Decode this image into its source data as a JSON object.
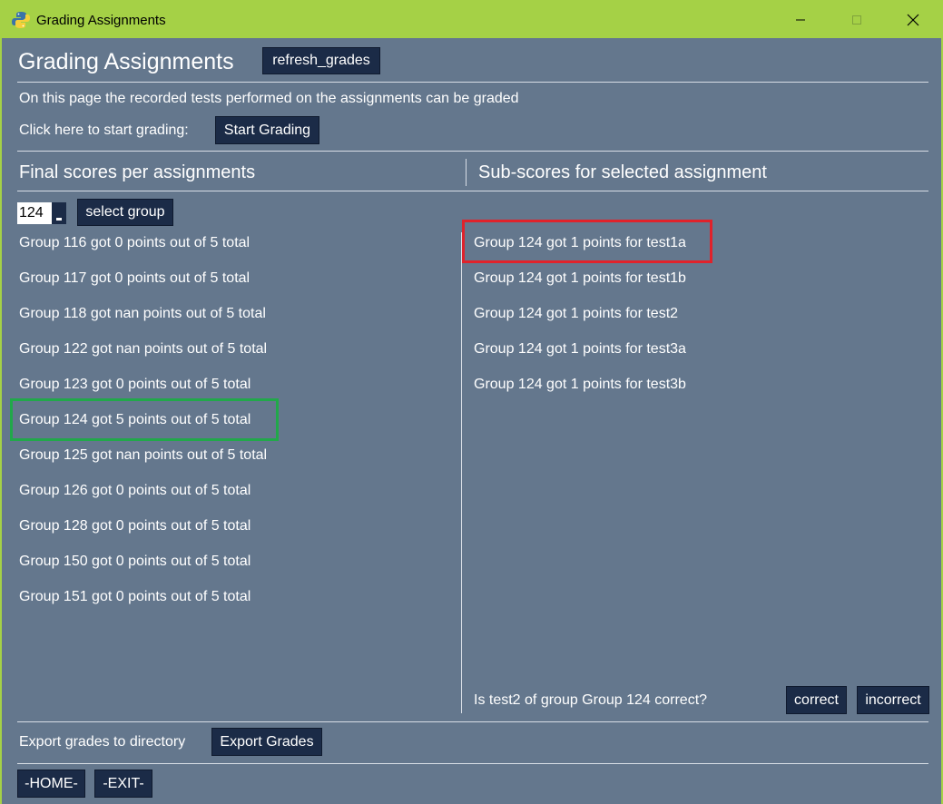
{
  "window": {
    "title": "Grading Assignments"
  },
  "header": {
    "title": "Grading Assignments",
    "refresh_label": "refresh_grades",
    "description": "On this page the recorded tests performed on the assignments can be graded",
    "start_prompt": "Click here to start grading:",
    "start_label": "Start Grading"
  },
  "left_panel": {
    "heading": "Final scores per assignments",
    "group_select_value": "124",
    "select_group_label": "select group",
    "items": [
      "Group 116 got 0 points out of 5 total",
      "Group 117 got 0 points out of 5 total",
      "Group 118 got nan points out of 5 total",
      "Group 122 got nan points out of 5 total",
      "Group 123 got 0 points out of 5 total",
      "Group 124 got 5 points out of 5 total",
      "Group 125 got nan points out of 5 total",
      "Group 126 got 0 points out of 5 total",
      "Group 128 got 0 points out of 5 total",
      "Group 150 got 0 points out of 5 total",
      "Group 151 got 0 points out of 5 total"
    ],
    "selected_index": 5
  },
  "right_panel": {
    "heading": "Sub-scores for selected assignment",
    "items": [
      "Group 124 got 1 points for test1a",
      "Group 124 got 1 points for test1b",
      "Group 124 got 1 points for test2",
      "Group 124 got 1 points for test3a",
      "Group 124 got 1 points for test3b"
    ],
    "selected_index": 0,
    "question": "Is test2 of group Group 124 correct?",
    "correct_label": "correct",
    "incorrect_label": "incorrect"
  },
  "footer": {
    "export_prompt": "Export grades to directory",
    "export_label": "Export Grades",
    "home_label": "-HOME-",
    "exit_label": "-EXIT-"
  },
  "colors": {
    "titlebar": "#a5d146",
    "background": "#64778d",
    "button": "#1b2b47",
    "highlight_green": "#21a84a",
    "highlight_red": "#e0222b"
  }
}
